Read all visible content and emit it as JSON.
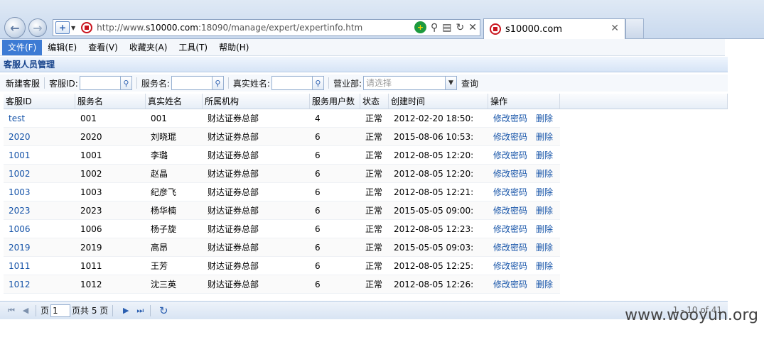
{
  "browser": {
    "url_prefix": "http://www.",
    "url_host": "s10000.com",
    "url_rest": ":18090/manage/expert/expertinfo.htm",
    "tab_title": "s10000.com"
  },
  "menu": [
    "文件(F)",
    "编辑(E)",
    "查看(V)",
    "收藏夹(A)",
    "工具(T)",
    "帮助(H)"
  ],
  "panel": {
    "title": "客服人员管理"
  },
  "toolbar": {
    "new_button": "新建客服",
    "id_label": "客服ID:",
    "service_name_label": "服务名:",
    "real_name_label": "真实姓名:",
    "branch_label": "营业部:",
    "branch_placeholder": "请选择",
    "query_button": "查询"
  },
  "table": {
    "columns": [
      "客服ID",
      "服务名",
      "真实姓名",
      "所属机构",
      "服务用户数",
      "状态",
      "创建时间",
      "操作"
    ],
    "op_change_pwd": "修改密码",
    "op_delete": "删除",
    "rows": [
      [
        "test",
        "001",
        "001",
        "财达证券总部",
        "4",
        "正常",
        "2012-02-20 18:50:"
      ],
      [
        "2020",
        "2020",
        "刘晓琨",
        "财达证券总部",
        "6",
        "正常",
        "2015-08-06 10:53:"
      ],
      [
        "1001",
        "1001",
        "李璐",
        "财达证券总部",
        "6",
        "正常",
        "2012-08-05 12:20:"
      ],
      [
        "1002",
        "1002",
        "赵晶",
        "财达证券总部",
        "6",
        "正常",
        "2012-08-05 12:20:"
      ],
      [
        "1003",
        "1003",
        "纪彦飞",
        "财达证券总部",
        "6",
        "正常",
        "2012-08-05 12:21:"
      ],
      [
        "2023",
        "2023",
        "杨华楠",
        "财达证券总部",
        "6",
        "正常",
        "2015-05-05 09:00:"
      ],
      [
        "1006",
        "1006",
        "杨子旋",
        "财达证券总部",
        "6",
        "正常",
        "2012-08-05 12:23:"
      ],
      [
        "2019",
        "2019",
        "高昂",
        "财达证券总部",
        "6",
        "正常",
        "2015-05-05 09:03:"
      ],
      [
        "1011",
        "1011",
        "王芳",
        "财达证券总部",
        "6",
        "正常",
        "2012-08-05 12:25:"
      ],
      [
        "1012",
        "1012",
        "沈三英",
        "财达证券总部",
        "6",
        "正常",
        "2012-08-05 12:26:"
      ]
    ]
  },
  "pager": {
    "page_label": "页",
    "page_value": "1",
    "total_label": "页共 5 页",
    "info": "1 - 10 of 41"
  },
  "watermark": "www.wooyun.org"
}
